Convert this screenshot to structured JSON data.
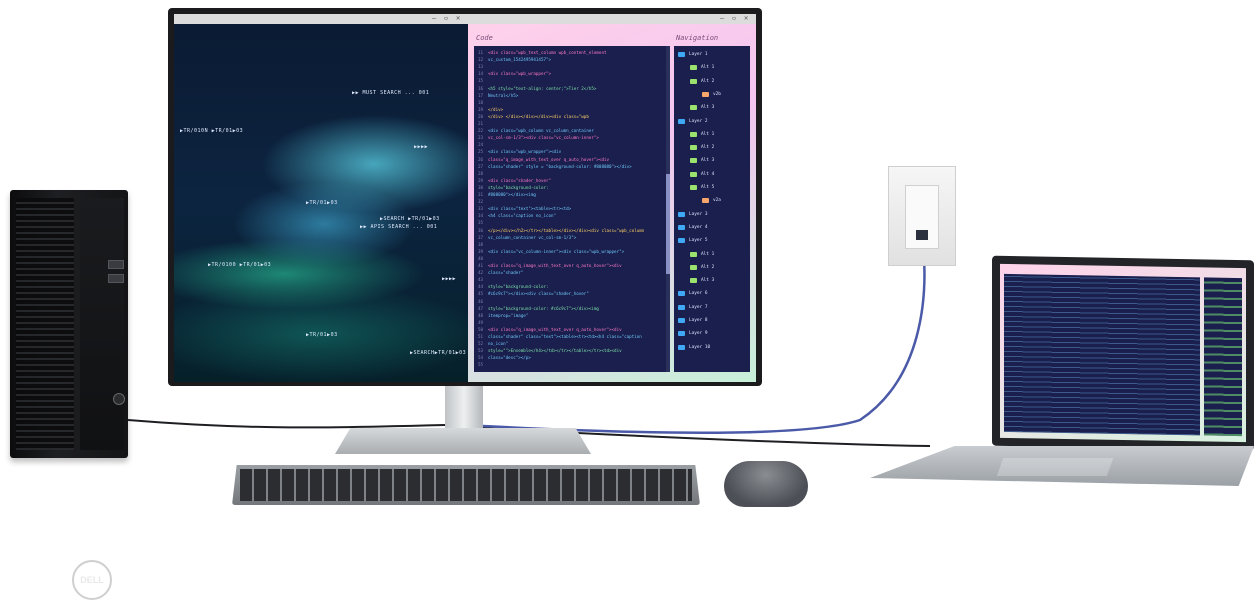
{
  "monitor": {
    "left_pane": {
      "hud_labels": [
        "▶▶ MUST SEARCH ... 001",
        "▶TR/010N ▶TR/01▶03",
        "▶▶▶▶",
        "▶TR/01▶03",
        "▶SEARCH ▶TR/01▶03",
        "▶▶ APIS SEARCH ... 001",
        "▶TR/0100 ▶TR/01▶03",
        "▶▶▶▶",
        "▶TR/01▶03",
        "▶SEARCH▶TR/01▶03"
      ]
    },
    "right_pane": {
      "code_label": "Code",
      "nav_label": "Navigation",
      "code_lines": [
        {
          "n": "11",
          "t": "<div class=\"wpb_text_column wpb_content_element"
        },
        {
          "n": "12",
          "t": "vc_custom_1542495941457\">"
        },
        {
          "n": "13",
          "t": ""
        },
        {
          "n": "14",
          "t": "<div class=\"wpb_wrapper\">"
        },
        {
          "n": "15",
          "t": ""
        },
        {
          "n": "16",
          "t": "<h5 style=\"text-align: center;\">Tier 2</h5>"
        },
        {
          "n": "17",
          "t": "Neutral</h5>"
        },
        {
          "n": "18",
          "t": ""
        },
        {
          "n": "19",
          "t": "</div>"
        },
        {
          "n": "20",
          "t": "</div> </div></div></div><div class=\"wpb"
        },
        {
          "n": "21",
          "t": ""
        },
        {
          "n": "22",
          "t": "<div class=\"wpb_column vc_column_container"
        },
        {
          "n": "23",
          "t": "vc_col-sm-1/3\"><div class=\"vc_column-inner\">"
        },
        {
          "n": "24",
          "t": ""
        },
        {
          "n": "25",
          "t": "<div class=\"wpb_wrapper\"><div"
        },
        {
          "n": "26",
          "t": "class=\"q_image_with_text_over q_auto_hover\"><div"
        },
        {
          "n": "27",
          "t": "class=\"shader\" style = \"background-color: #808080\"></div>"
        },
        {
          "n": "28",
          "t": ""
        },
        {
          "n": "29",
          "t": "<div class=\"shader_hover\""
        },
        {
          "n": "30",
          "t": "style=\"background-color:"
        },
        {
          "n": "31",
          "t": "#808080\"></div><img"
        },
        {
          "n": "32",
          "t": ""
        },
        {
          "n": "33",
          "t": "<div class=\"text\"><table><tr><td>"
        },
        {
          "n": "34",
          "t": "<h4 class=\"caption no_icon\""
        },
        {
          "n": "35",
          "t": ""
        },
        {
          "n": "36",
          "t": "</p></div></h2></tr></table></div></div><div class=\"wpb_column"
        },
        {
          "n": "37",
          "t": "vc_column_container vc_col-sm-1/3\">"
        },
        {
          "n": "38",
          "t": ""
        },
        {
          "n": "39",
          "t": "<div class=\"vc_column-inner\"><div class=\"wpb_wrapper\">"
        },
        {
          "n": "40",
          "t": ""
        },
        {
          "n": "41",
          "t": "<div class=\"q_image_with_text_over q_auto_hover\"><div"
        },
        {
          "n": "42",
          "t": "class=\"shader\""
        },
        {
          "n": "43",
          "t": ""
        },
        {
          "n": "44",
          "t": "style=\"background-color:"
        },
        {
          "n": "45",
          "t": "#c6c9c7\"></div><div class=\"shader_hover\""
        },
        {
          "n": "46",
          "t": ""
        },
        {
          "n": "47",
          "t": "style=\"background-color: #c6c9c7\"></div><img"
        },
        {
          "n": "48",
          "t": "itemprop=\"image\""
        },
        {
          "n": "49",
          "t": ""
        },
        {
          "n": "50",
          "t": "<div class=\"q_image_with_text_over q_auto_hover\"><div"
        },
        {
          "n": "51",
          "t": "class=\"shader\" class=\"text\"><table><tr><td><h4 class=\"caption"
        },
        {
          "n": "52",
          "t": "no_icon\""
        },
        {
          "n": "53",
          "t": "style=\"\">Ensemble</h4></td></tr></table></tr><td><div"
        },
        {
          "n": "54",
          "t": "class=\"desc\"></p>"
        },
        {
          "n": "55",
          "t": ""
        }
      ],
      "nav_items": [
        {
          "label": "Layer 1",
          "color": "#3fa9f5",
          "indent": 0
        },
        {
          "label": "Alt 1",
          "color": "#9be36f",
          "indent": 1
        },
        {
          "label": "Alt 2",
          "color": "#9be36f",
          "indent": 1
        },
        {
          "label": "v2b",
          "color": "#f7a56a",
          "indent": 2
        },
        {
          "label": "Alt 3",
          "color": "#9be36f",
          "indent": 1
        },
        {
          "label": "Layer 2",
          "color": "#3fa9f5",
          "indent": 0
        },
        {
          "label": "Alt 1",
          "color": "#9be36f",
          "indent": 1
        },
        {
          "label": "Alt 2",
          "color": "#9be36f",
          "indent": 1
        },
        {
          "label": "Alt 3",
          "color": "#9be36f",
          "indent": 1
        },
        {
          "label": "Alt 4",
          "color": "#9be36f",
          "indent": 1
        },
        {
          "label": "Alt 5",
          "color": "#9be36f",
          "indent": 1
        },
        {
          "label": "v2a",
          "color": "#f7a56a",
          "indent": 2
        },
        {
          "label": "Layer 3",
          "color": "#3fa9f5",
          "indent": 0
        },
        {
          "label": "Layer 4",
          "color": "#3fa9f5",
          "indent": 0
        },
        {
          "label": "Layer 5",
          "color": "#3fa9f5",
          "indent": 0
        },
        {
          "label": "Alt 1",
          "color": "#9be36f",
          "indent": 1
        },
        {
          "label": "Alt 2",
          "color": "#9be36f",
          "indent": 1
        },
        {
          "label": "Alt 3",
          "color": "#9be36f",
          "indent": 1
        },
        {
          "label": "Layer 6",
          "color": "#3fa9f5",
          "indent": 0
        },
        {
          "label": "Layer 7",
          "color": "#3fa9f5",
          "indent": 0
        },
        {
          "label": "Layer 8",
          "color": "#3fa9f5",
          "indent": 0
        },
        {
          "label": "Layer 9",
          "color": "#3fa9f5",
          "indent": 0
        },
        {
          "label": "Layer 10",
          "color": "#3fa9f5",
          "indent": 0
        }
      ]
    }
  },
  "tower": {
    "logo": "DELL"
  },
  "colors": {
    "cable": "#4a5aa8",
    "code_bg": "#1a1f4d"
  }
}
